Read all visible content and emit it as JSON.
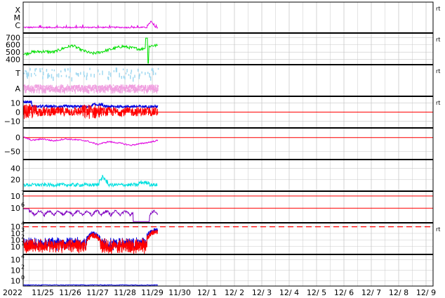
{
  "chart_data": {
    "type": "line",
    "start_year_label": "2022",
    "x_dates": [
      "11/25",
      "11/26",
      "11/27",
      "11/28",
      "11/29",
      "11/30",
      "12/ 1",
      "12/ 2",
      "12/ 3",
      "12/ 4",
      "12/ 5",
      "12/ 6",
      "12/ 7",
      "12/ 8",
      "12/ 9"
    ],
    "data_end_day": 5.2,
    "colors": {
      "magenta": "#e000e0",
      "green": "#00e000",
      "light_blue": "#a0d8f0",
      "pink": "#f0a0e0",
      "blue": "#0000e0",
      "red": "#ff0000",
      "purple": "#8000c0",
      "cyan": "#00e0e0",
      "grid": "#c8c8c8"
    },
    "panels": [
      {
        "id": "xray",
        "y_tick_labels": [
          "X",
          "M",
          "C"
        ],
        "right_marker": "rt",
        "series": [
          {
            "color": "magenta",
            "baseline": 0.85,
            "spike_day": 4.95
          }
        ]
      },
      {
        "id": "solar-wind-speed",
        "y_tick_labels": [
          "700",
          "600",
          "500",
          "400"
        ],
        "y_ticks": [
          700,
          600,
          500,
          400
        ],
        "ylim": [
          330,
          760
        ],
        "right_marker": "rt",
        "series": [
          {
            "color": "green",
            "points": [
              [
                0,
                440
              ],
              [
                0.3,
                470
              ],
              [
                0.6,
                500
              ],
              [
                1.0,
                510
              ],
              [
                1.4,
                500
              ],
              [
                1.8,
                560
              ],
              [
                2.1,
                590
              ],
              [
                2.4,
                530
              ],
              [
                2.8,
                480
              ],
              [
                3.1,
                500
              ],
              [
                3.5,
                540
              ],
              [
                3.9,
                580
              ],
              [
                4.2,
                560
              ],
              [
                4.6,
                540
              ],
              [
                4.8,
                570
              ],
              [
                5.0,
                590
              ],
              [
                5.2,
                590
              ]
            ]
          }
        ]
      },
      {
        "id": "ta-panel",
        "y_tick_labels": [
          "T",
          "A"
        ],
        "right_marker": "rt",
        "series": [
          {
            "color": "light_blue"
          },
          {
            "color": "pink"
          }
        ]
      },
      {
        "id": "bz-panel",
        "y_tick_labels": [
          "10",
          "0",
          "−10"
        ],
        "y_ticks": [
          10,
          0,
          -10
        ],
        "ylim": [
          -17,
          17
        ],
        "zero_line": 0,
        "right_marker": "rt",
        "series": [
          {
            "color": "blue",
            "mean": 6
          },
          {
            "color": "red",
            "mean": 0
          }
        ]
      },
      {
        "id": "dst-panel",
        "y_tick_labels": [
          "0",
          "−50"
        ],
        "y_ticks": [
          0,
          -50
        ],
        "ylim": [
          -80,
          35
        ],
        "zero_line": 0,
        "series": [
          {
            "color": "magenta",
            "points": [
              [
                0,
                25
              ],
              [
                0.2,
                5
              ],
              [
                0.6,
                -10
              ],
              [
                1.0,
                -5
              ],
              [
                1.4,
                -12
              ],
              [
                1.8,
                -5
              ],
              [
                2.2,
                -8
              ],
              [
                2.6,
                -12
              ],
              [
                3.0,
                -25
              ],
              [
                3.4,
                -15
              ],
              [
                3.8,
                -20
              ],
              [
                4.2,
                -28
              ],
              [
                4.6,
                -22
              ],
              [
                5.0,
                -15
              ],
              [
                5.2,
                -10
              ]
            ]
          }
        ]
      },
      {
        "id": "density-panel",
        "y_tick_labels": [
          "40",
          "20"
        ],
        "y_ticks": [
          40,
          20
        ],
        "ylim": [
          0,
          55
        ],
        "series": [
          {
            "color": "cyan",
            "mean": 11
          }
        ]
      },
      {
        "id": "proton-flux-panel",
        "y_tick_labels": [
          "10",
          "10"
        ],
        "y_ticks": [
          7,
          6
        ],
        "exponents": [
          "7",
          "6"
        ],
        "ylim": [
          4.8,
          7.4
        ],
        "ref_lines": [
          7,
          6
        ],
        "series": [
          {
            "color": "purple",
            "mean": 5.5
          }
        ]
      },
      {
        "id": "electron-flux-panel",
        "y_tick_labels": [
          "10",
          "10",
          "10",
          "10"
        ],
        "y_ticks": [
          4,
          3,
          2,
          1
        ],
        "exponents": [
          "4",
          "3",
          "2",
          "1"
        ],
        "ylim": [
          -0.2,
          4.6
        ],
        "ref_line_dashed": 4,
        "right_marker": "rt",
        "series": [
          {
            "color": "blue"
          },
          {
            "color": "red"
          }
        ]
      },
      {
        "id": "bottom-panel",
        "y_tick_labels": [
          "10",
          "10",
          "10"
        ],
        "y_ticks": [
          4,
          2,
          0
        ],
        "exponents": [
          "4",
          "2",
          "0"
        ],
        "ylim": [
          -1,
          5
        ],
        "series": [
          {
            "color": "blue",
            "mean": -0.8
          }
        ]
      }
    ]
  }
}
